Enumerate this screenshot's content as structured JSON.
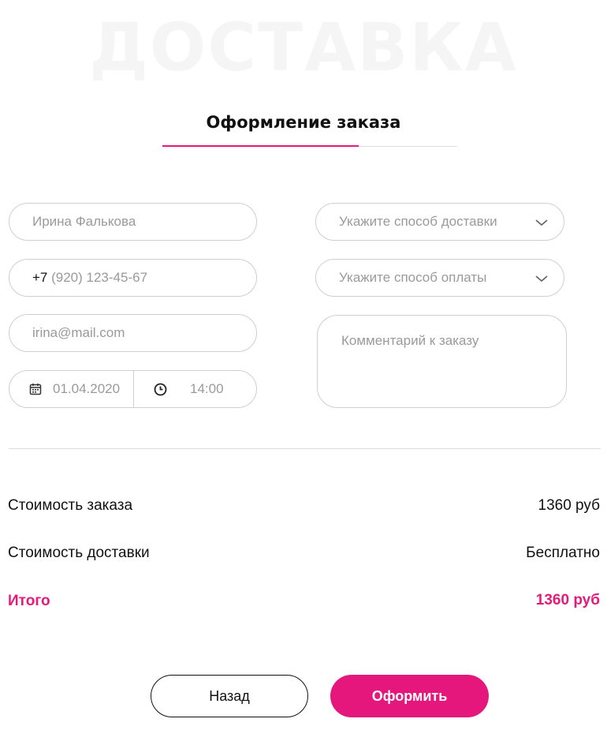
{
  "header": {
    "watermark": "ДОСТАВКА",
    "title": "Оформление заказа"
  },
  "form": {
    "name_placeholder": "Ирина Фалькова",
    "phone_prefix": "+7",
    "phone_placeholder": " (920) 123-45-67",
    "email_placeholder": "irina@mail.com",
    "date_value": "01.04.2020",
    "time_value": "14:00",
    "delivery_select": "Укажите способ доставки",
    "payment_select": "Укажите способ оплаты",
    "comment_placeholder": "Комментарий к заказу"
  },
  "summary": {
    "order_cost_label": "Стоимость заказа",
    "order_cost_value": "1360 руб",
    "delivery_cost_label": "Стоимость доставки",
    "delivery_cost_value": "Бесплатно",
    "total_label": "Итого",
    "total_value": "1360 руб"
  },
  "actions": {
    "back_label": "Назад",
    "submit_label": "Оформить"
  },
  "icons": {
    "calendar": "calendar-icon",
    "clock": "clock-icon",
    "chevron": "chevron-down-icon"
  },
  "colors": {
    "accent": "#e51b7c",
    "border": "#cfcfcf",
    "placeholder": "#9a9a9a"
  }
}
